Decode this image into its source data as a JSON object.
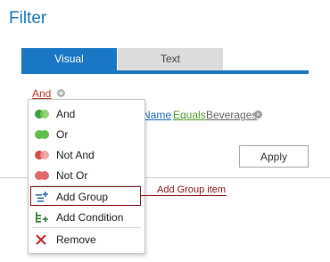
{
  "title": "Filter",
  "tabs": [
    {
      "label": "Visual",
      "active": true
    },
    {
      "label": "Text",
      "active": false
    }
  ],
  "group_operator": "And",
  "condition": {
    "field": "Name",
    "operator": "Equals",
    "value": "Beverages"
  },
  "apply_label": "Apply",
  "menu": {
    "items": [
      {
        "label": "And",
        "icon": "and-group-icon"
      },
      {
        "label": "Or",
        "icon": "or-group-icon"
      },
      {
        "label": "Not And",
        "icon": "not-and-group-icon"
      },
      {
        "label": "Not Or",
        "icon": "not-or-group-icon"
      },
      {
        "label": "Add Group",
        "icon": "add-group-icon"
      },
      {
        "label": "Add Condition",
        "icon": "add-condition-icon"
      },
      {
        "label": "Remove",
        "icon": "remove-icon"
      }
    ]
  },
  "callout": "Add Group item",
  "colors": {
    "accent": "#1a77c5",
    "and_icon": "#4caf50",
    "not_icon": "#e06a6a",
    "callout": "#8b1a1a"
  }
}
